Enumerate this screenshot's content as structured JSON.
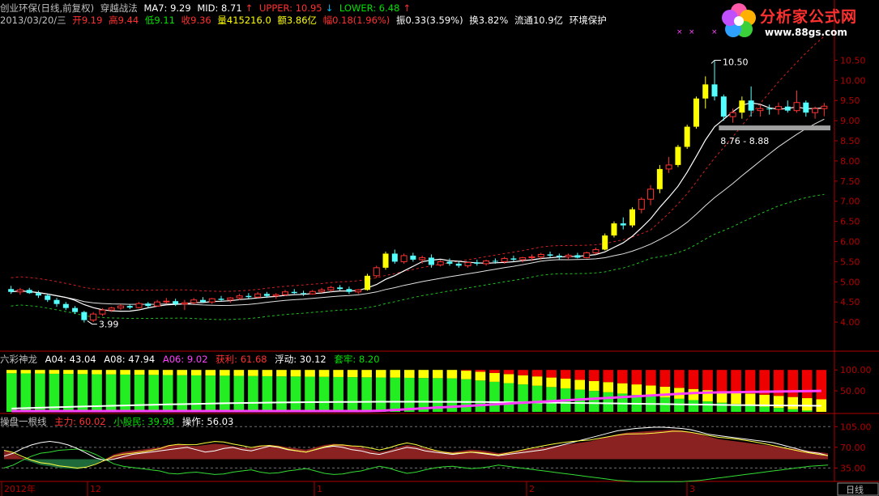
{
  "colors": {
    "up": "#ff3232",
    "down": "#54ffff",
    "yellow": "#ffff00",
    "white": "#ffffff",
    "red_axis": "#b00000",
    "green": "#00e000",
    "magenta": "#ff00ff",
    "text": "#c0c0c0"
  },
  "logo": {
    "text": "分析家公式网",
    "url": "www.88gs.com"
  },
  "header": {
    "title": "创业环保(日线,前复权)",
    "study": "穿越战法",
    "ma7": "MA7: 9.29",
    "mid": "MID: 8.71",
    "upper": "UPPER: 10.95",
    "lower": "LOWER: 6.48",
    "date": "2013/03/20/三",
    "open": "开9.19",
    "high": "高9.44",
    "low": "低9.11",
    "close": "收9.36",
    "volume": "量415216.0",
    "amount": "额3.86亿",
    "change": "幅0.18(1.96%)",
    "amplitude": "振0.33(3.59%)",
    "turnover": "换3.82%",
    "float": "流通10.9亿",
    "sector": "环境保护"
  },
  "panel2": {
    "name": "六彩神龙",
    "a04": "A04: 43.04",
    "a08": "A08: 47.94",
    "a06": "A06: 9.02",
    "profit": "获利: 61.68",
    "float": "浮动: 30.12",
    "trapped": "套牢: 8.20"
  },
  "panel3": {
    "name": "操盘一根线",
    "main": "主力: 60.02",
    "retail": "小股民: 39.98",
    "op": "操作: 56.03"
  },
  "annotations": {
    "high": "10.50",
    "low": "3.99",
    "range": "8.76 - 8.88"
  },
  "x_axis": {
    "labels": [
      "2012年",
      "12",
      "1",
      "2",
      "3"
    ],
    "period": "日线"
  },
  "chart_data": [
    {
      "type": "candlestick",
      "ylim": [
        3.6,
        10.75
      ],
      "yticks": [
        "10.50",
        "10.00",
        "9.50",
        "9.00",
        "8.50",
        "8.00",
        "7.50",
        "7.00",
        "6.50",
        "6.00",
        "5.50",
        "5.00",
        "4.50",
        "4.00"
      ],
      "ytick_values": [
        10.5,
        10.0,
        9.5,
        9.0,
        8.5,
        8.0,
        7.5,
        7.0,
        6.5,
        6.0,
        5.5,
        5.0,
        4.5,
        4.0
      ],
      "ohlc": [
        [
          4.82,
          4.9,
          4.7,
          4.75
        ],
        [
          4.75,
          4.85,
          4.68,
          4.8
        ],
        [
          4.8,
          4.85,
          4.7,
          4.72
        ],
        [
          4.72,
          4.78,
          4.6,
          4.66
        ],
        [
          4.66,
          4.7,
          4.5,
          4.55
        ],
        [
          4.55,
          4.6,
          4.38,
          4.45
        ],
        [
          4.45,
          4.5,
          4.3,
          4.35
        ],
        [
          4.35,
          4.4,
          4.2,
          4.25
        ],
        [
          4.25,
          4.28,
          3.99,
          4.05
        ],
        [
          4.05,
          4.25,
          4.0,
          4.2
        ],
        [
          4.2,
          4.35,
          4.15,
          4.3
        ],
        [
          4.3,
          4.38,
          4.25,
          4.35
        ],
        [
          4.35,
          4.45,
          4.3,
          4.4
        ],
        [
          4.4,
          4.45,
          4.32,
          4.36
        ],
        [
          4.36,
          4.5,
          4.34,
          4.46
        ],
        [
          4.46,
          4.5,
          4.35,
          4.4
        ],
        [
          4.4,
          4.55,
          4.38,
          4.5
        ],
        [
          4.5,
          4.6,
          4.45,
          4.52
        ],
        [
          4.52,
          4.58,
          4.4,
          4.45
        ],
        [
          4.45,
          4.55,
          4.3,
          4.48
        ],
        [
          4.48,
          4.6,
          4.45,
          4.55
        ],
        [
          4.55,
          4.62,
          4.48,
          4.5
        ],
        [
          4.5,
          4.6,
          4.45,
          4.58
        ],
        [
          4.58,
          4.65,
          4.52,
          4.55
        ],
        [
          4.55,
          4.62,
          4.48,
          4.6
        ],
        [
          4.6,
          4.7,
          4.55,
          4.65
        ],
        [
          4.65,
          4.72,
          4.58,
          4.62
        ],
        [
          4.62,
          4.75,
          4.6,
          4.7
        ],
        [
          4.7,
          4.75,
          4.6,
          4.65
        ],
        [
          4.65,
          4.72,
          4.58,
          4.68
        ],
        [
          4.68,
          4.8,
          4.65,
          4.75
        ],
        [
          4.75,
          4.82,
          4.7,
          4.72
        ],
        [
          4.72,
          4.78,
          4.65,
          4.7
        ],
        [
          4.7,
          4.8,
          4.68,
          4.76
        ],
        [
          4.76,
          4.85,
          4.72,
          4.8
        ],
        [
          4.8,
          4.9,
          4.75,
          4.86
        ],
        [
          4.86,
          4.92,
          4.78,
          4.82
        ],
        [
          4.82,
          4.88,
          4.7,
          4.75
        ],
        [
          4.75,
          4.82,
          4.7,
          4.8
        ],
        [
          4.8,
          5.2,
          4.78,
          5.15
        ],
        [
          5.15,
          5.4,
          5.1,
          5.35
        ],
        [
          5.35,
          5.75,
          5.3,
          5.7
        ],
        [
          5.7,
          5.8,
          5.45,
          5.5
        ],
        [
          5.5,
          5.7,
          5.45,
          5.65
        ],
        [
          5.65,
          5.72,
          5.5,
          5.55
        ],
        [
          5.55,
          5.65,
          5.45,
          5.6
        ],
        [
          5.6,
          5.68,
          5.35,
          5.42
        ],
        [
          5.42,
          5.55,
          5.38,
          5.5
        ],
        [
          5.5,
          5.58,
          5.4,
          5.45
        ],
        [
          5.45,
          5.52,
          5.35,
          5.4
        ],
        [
          5.4,
          5.5,
          5.35,
          5.48
        ],
        [
          5.48,
          5.55,
          5.4,
          5.45
        ],
        [
          5.45,
          5.55,
          5.4,
          5.52
        ],
        [
          5.52,
          5.58,
          5.45,
          5.5
        ],
        [
          5.5,
          5.62,
          5.45,
          5.58
        ],
        [
          5.58,
          5.65,
          5.5,
          5.55
        ],
        [
          5.55,
          5.62,
          5.48,
          5.6
        ],
        [
          5.6,
          5.68,
          5.52,
          5.62
        ],
        [
          5.62,
          5.72,
          5.55,
          5.68
        ],
        [
          5.68,
          5.75,
          5.6,
          5.65
        ],
        [
          5.65,
          5.7,
          5.55,
          5.62
        ],
        [
          5.62,
          5.7,
          5.55,
          5.66
        ],
        [
          5.66,
          5.72,
          5.58,
          5.6
        ],
        [
          5.6,
          5.75,
          5.58,
          5.72
        ],
        [
          5.72,
          5.85,
          5.68,
          5.8
        ],
        [
          5.8,
          6.2,
          5.78,
          6.15
        ],
        [
          6.15,
          6.5,
          6.1,
          6.45
        ],
        [
          6.45,
          6.6,
          6.3,
          6.4
        ],
        [
          6.4,
          6.85,
          6.35,
          6.8
        ],
        [
          6.8,
          7.1,
          6.7,
          7.05
        ],
        [
          7.05,
          7.4,
          6.9,
          7.3
        ],
        [
          7.3,
          7.9,
          7.2,
          7.8
        ],
        [
          7.8,
          8.1,
          7.7,
          7.9
        ],
        [
          7.9,
          8.4,
          7.85,
          8.35
        ],
        [
          8.35,
          8.9,
          8.3,
          8.85
        ],
        [
          8.85,
          9.6,
          8.8,
          9.55
        ],
        [
          9.55,
          10.1,
          9.3,
          9.9
        ],
        [
          9.9,
          10.5,
          9.5,
          9.6
        ],
        [
          9.6,
          9.65,
          9.0,
          9.1
        ],
        [
          9.1,
          9.3,
          8.95,
          9.2
        ],
        [
          9.2,
          9.6,
          9.05,
          9.5
        ],
        [
          9.5,
          9.85,
          9.1,
          9.25
        ],
        [
          9.25,
          9.4,
          9.1,
          9.3
        ],
        [
          9.3,
          9.4,
          9.15,
          9.28
        ],
        [
          9.28,
          9.45,
          9.15,
          9.35
        ],
        [
          9.35,
          9.5,
          9.2,
          9.25
        ],
        [
          9.25,
          9.75,
          9.2,
          9.45
        ],
        [
          9.45,
          9.5,
          9.1,
          9.2
        ],
        [
          9.2,
          9.35,
          9.05,
          9.3
        ],
        [
          9.3,
          9.44,
          9.11,
          9.36
        ]
      ],
      "support_band": [
        8.76,
        8.88
      ]
    },
    {
      "type": "bar",
      "ylim": [
        0,
        110
      ],
      "yticks": [
        "100.00",
        "50.00"
      ],
      "ytick_values": [
        100,
        50
      ],
      "profit_start": 90,
      "profit_end": 62,
      "float_start": 10,
      "float_end": 30,
      "trapped_start": 0,
      "trapped_end": 8
    },
    {
      "type": "area",
      "ylim": [
        15,
        115
      ],
      "yticks": [
        "105.00",
        "70.00",
        "35.00"
      ],
      "ytick_values": [
        105,
        70,
        35
      ],
      "main_force": [
        65,
        60,
        52,
        45,
        40,
        38,
        35,
        34,
        33,
        36,
        42,
        50,
        58,
        62,
        64,
        66,
        68,
        70,
        74,
        75,
        73,
        72,
        74,
        76,
        75,
        72,
        70,
        68,
        72,
        74,
        73,
        70,
        68,
        66,
        70,
        74,
        76,
        75,
        72,
        70,
        66,
        62,
        65,
        70,
        74,
        72,
        68,
        65,
        63,
        62,
        64,
        66,
        65,
        63,
        60,
        62,
        64,
        66,
        68,
        70,
        72,
        74,
        76,
        78,
        80,
        84,
        88,
        92,
        95,
        96,
        97,
        98,
        99,
        100,
        99,
        96,
        92,
        88,
        84,
        82,
        80,
        78,
        76,
        74,
        72,
        70,
        68,
        66,
        64,
        62,
        60
      ],
      "retail": [
        35,
        40,
        48,
        55,
        60,
        62,
        65,
        66,
        67,
        64,
        58,
        50,
        42,
        38,
        36,
        34,
        32,
        30,
        26,
        25,
        27,
        28,
        26,
        24,
        25,
        28,
        30,
        32,
        28,
        26,
        27,
        30,
        32,
        34,
        30,
        26,
        24,
        25,
        28,
        30,
        34,
        38,
        35,
        30,
        26,
        28,
        32,
        35,
        37,
        38,
        36,
        34,
        35,
        37,
        40,
        38,
        36,
        34,
        32,
        30,
        28,
        26,
        24,
        22,
        20,
        18,
        16,
        14,
        13,
        12,
        12,
        12,
        12,
        12,
        12,
        13,
        14,
        16,
        18,
        20,
        22,
        24,
        26,
        28,
        30,
        32,
        34,
        36,
        38,
        39,
        40
      ],
      "operation": [
        55,
        60,
        68,
        74,
        78,
        80,
        78,
        74,
        68,
        60,
        52,
        48,
        50,
        54,
        58,
        60,
        62,
        64,
        66,
        68,
        70,
        66,
        62,
        64,
        68,
        70,
        66,
        64,
        68,
        72,
        70,
        66,
        64,
        62,
        66,
        70,
        72,
        70,
        66,
        64,
        60,
        58,
        62,
        66,
        70,
        68,
        64,
        62,
        60,
        58,
        60,
        62,
        60,
        58,
        56,
        58,
        60,
        62,
        64,
        66,
        70,
        74,
        78,
        82,
        86,
        90,
        94,
        98,
        100,
        102,
        103,
        104,
        104,
        103,
        102,
        100,
        96,
        92,
        90,
        88,
        86,
        84,
        82,
        80,
        78,
        74,
        70,
        66,
        62,
        60,
        56
      ]
    }
  ]
}
